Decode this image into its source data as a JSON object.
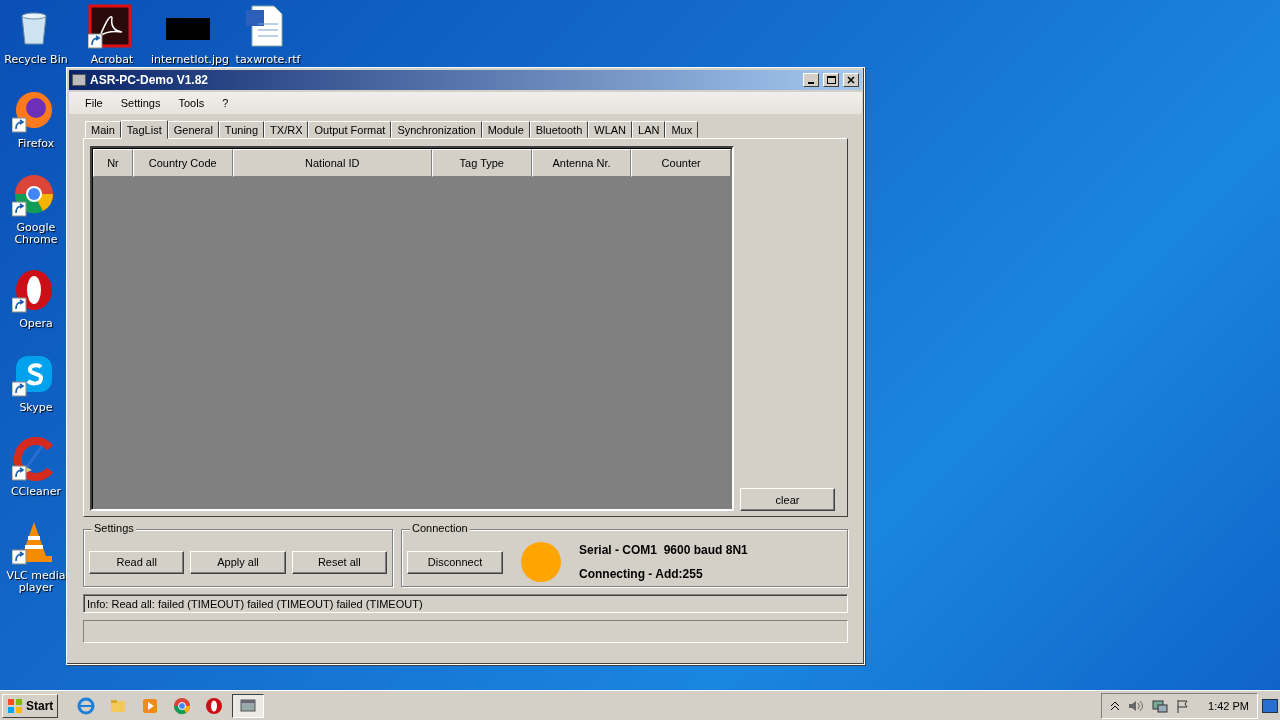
{
  "desktop": {
    "top_row": [
      {
        "kind": "acrobat",
        "label": "Acrobat"
      },
      {
        "kind": "image",
        "label": "internetlot.jpg"
      },
      {
        "kind": "document",
        "label": "taxwrote.rtf"
      }
    ],
    "column": [
      {
        "kind": "recycle",
        "label": "Recycle Bin"
      },
      {
        "kind": "firefox",
        "label": "Firefox"
      },
      {
        "kind": "chrome",
        "label": "Google Chrome"
      },
      {
        "kind": "opera",
        "label": "Opera"
      },
      {
        "kind": "skype",
        "label": "Skype"
      },
      {
        "kind": "ccleaner",
        "label": "CCleaner"
      },
      {
        "kind": "vlc",
        "label": "VLC media player"
      }
    ]
  },
  "window": {
    "title": "ASR-PC-Demo V1.82",
    "menu": [
      "File",
      "Settings",
      "Tools",
      "?"
    ],
    "tabs": [
      {
        "label": "Main",
        "selected": false
      },
      {
        "label": "TagList",
        "selected": true
      },
      {
        "label": "General",
        "selected": false
      },
      {
        "label": "Tuning",
        "selected": false
      },
      {
        "label": "TX/RX",
        "selected": false
      },
      {
        "label": "Output Format",
        "selected": false
      },
      {
        "label": "Synchronization",
        "selected": false
      },
      {
        "label": "Module",
        "selected": false
      },
      {
        "label": "Bluetooth",
        "selected": false
      },
      {
        "label": "WLAN",
        "selected": false
      },
      {
        "label": "LAN",
        "selected": false
      },
      {
        "label": "Mux",
        "selected": false
      }
    ],
    "table": {
      "columns": [
        "Nr",
        "Country Code",
        "National ID",
        "Tag Type",
        "Antenna Nr.",
        "Counter"
      ]
    },
    "clear_button": "clear",
    "settings": {
      "title": "Settings",
      "buttons": [
        "Read all",
        "Apply all",
        "Reset all"
      ]
    },
    "connection": {
      "title": "Connection",
      "button": "Disconnect",
      "status_light": {
        "color": "#ffa500"
      },
      "lines": [
        "Serial - COM1  9600 baud 8N1",
        "Connecting - Add:255"
      ]
    },
    "info": "Info: Read all: failed (TIMEOUT) failed (TIMEOUT) failed (TIMEOUT)"
  },
  "taskbar": {
    "start": "Start",
    "apps": [
      {
        "kind": "ie",
        "active": false
      },
      {
        "kind": "folder",
        "active": false
      },
      {
        "kind": "media",
        "active": false
      },
      {
        "kind": "chrome",
        "active": false
      },
      {
        "kind": "opera",
        "active": false
      },
      {
        "kind": "window",
        "active": true
      }
    ],
    "clock": "1:42 PM"
  }
}
